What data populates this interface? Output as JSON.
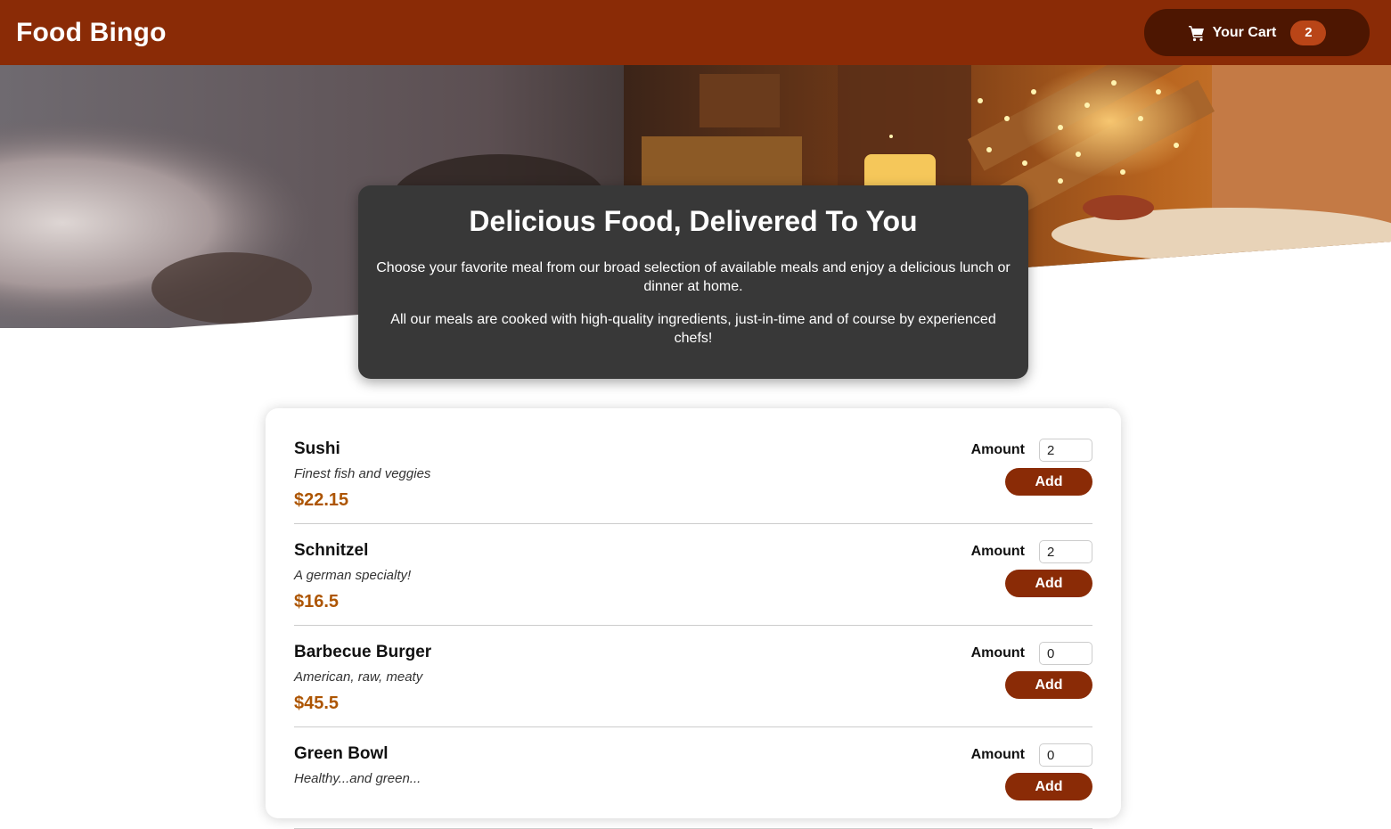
{
  "header": {
    "title": "Food Bingo",
    "cart": {
      "label": "Your Cart",
      "count": "2",
      "icon": "shopping-cart-icon"
    }
  },
  "summary": {
    "title": "Delicious Food, Delivered To You",
    "paragraphs": [
      "Choose your favorite meal from our broad selection of available meals and enjoy a delicious lunch or dinner at home.",
      "All our meals are cooked with high-quality ingredients, just-in-time and of course by experienced chefs!"
    ]
  },
  "meals": [
    {
      "name": "Sushi",
      "description": "Finest fish and veggies",
      "price": "$22.15",
      "amount_label": "Amount",
      "amount": "2",
      "add_label": "Add"
    },
    {
      "name": "Schnitzel",
      "description": "A german specialty!",
      "price": "$16.5",
      "amount_label": "Amount",
      "amount": "2",
      "add_label": "Add"
    },
    {
      "name": "Barbecue Burger",
      "description": "American, raw, meaty",
      "price": "$45.5",
      "amount_label": "Amount",
      "amount": "0",
      "add_label": "Add"
    },
    {
      "name": "Green Bowl",
      "description": "Healthy...and green...",
      "price": "",
      "amount_label": "Amount",
      "amount": "0",
      "add_label": "Add"
    }
  ],
  "colors": {
    "header": "#8a2b06",
    "cart_button": "#4d1601",
    "cart_badge": "#b94517",
    "summary_bg": "#383838",
    "price": "#ad5502",
    "add_button": "#8a2b06"
  }
}
